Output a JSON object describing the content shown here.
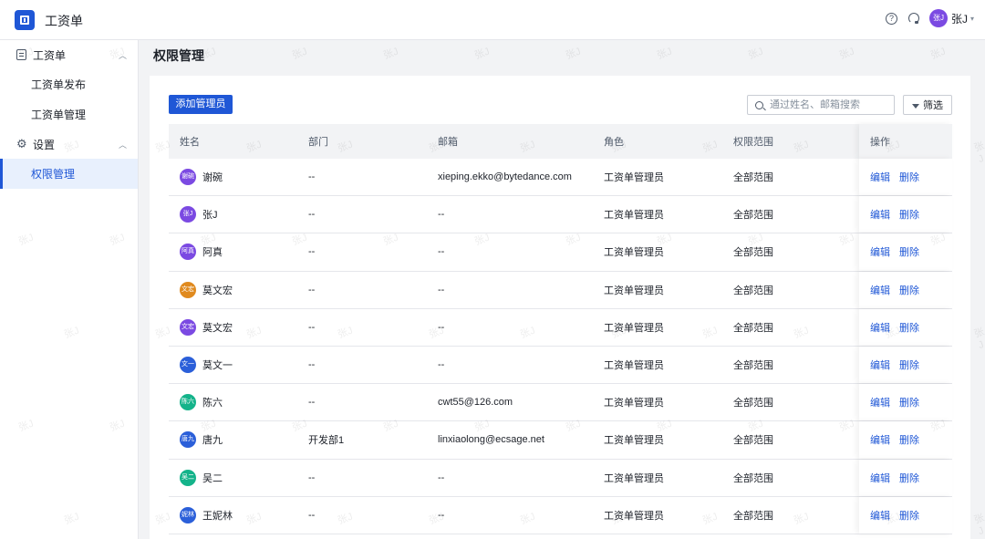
{
  "header": {
    "app_title": "工资单",
    "user_avatar_text": "张J",
    "user_name": "张J"
  },
  "sidebar": {
    "groups": [
      {
        "label": "工资单",
        "items": [
          "工资单发布",
          "工资单管理"
        ]
      },
      {
        "label": "设置",
        "items": [
          "权限管理"
        ]
      }
    ],
    "active_item": "权限管理"
  },
  "main": {
    "page_title": "权限管理",
    "add_button_label": "添加管理员",
    "search_placeholder": "通过姓名、邮箱搜索",
    "filter_label": "筛选",
    "table": {
      "columns": [
        "姓名",
        "部门",
        "邮箱",
        "角色",
        "权限范围",
        "操作"
      ],
      "rows": [
        {
          "avatar": "谢碗",
          "avatar_color": "#7b4ae2",
          "name": "谢碗",
          "dept": "--",
          "email": "xieping.ekko@bytedance.com",
          "role": "工资单管理员",
          "scope": "全部范围"
        },
        {
          "avatar": "张J",
          "avatar_color": "#7b4ae2",
          "name": "张J",
          "dept": "--",
          "email": "--",
          "role": "工资单管理员",
          "scope": "全部范围"
        },
        {
          "avatar": "阿真",
          "avatar_color": "#7b4ae2",
          "name": "阿真",
          "dept": "--",
          "email": "--",
          "role": "工资单管理员",
          "scope": "全部范围"
        },
        {
          "avatar": "文宏",
          "avatar_color": "#e08a1e",
          "name": "莫文宏",
          "dept": "--",
          "email": "--",
          "role": "工资单管理员",
          "scope": "全部范围"
        },
        {
          "avatar": "文宏",
          "avatar_color": "#7b4ae2",
          "name": "莫文宏",
          "dept": "--",
          "email": "--",
          "role": "工资单管理员",
          "scope": "全部范围"
        },
        {
          "avatar": "文一",
          "avatar_color": "#2b5fd9",
          "name": "莫文一",
          "dept": "--",
          "email": "--",
          "role": "工资单管理员",
          "scope": "全部范围"
        },
        {
          "avatar": "陈六",
          "avatar_color": "#14b38a",
          "name": "陈六",
          "dept": "--",
          "email": "cwt55@126.com",
          "role": "工资单管理员",
          "scope": "全部范围"
        },
        {
          "avatar": "唐九",
          "avatar_color": "#2b5fd9",
          "name": "唐九",
          "dept": "开发部1",
          "email": "linxiaolong@ecsage.net",
          "role": "工资单管理员",
          "scope": "全部范围"
        },
        {
          "avatar": "吴二",
          "avatar_color": "#14b38a",
          "name": "吴二",
          "dept": "--",
          "email": "--",
          "role": "工资单管理员",
          "scope": "全部范围"
        },
        {
          "avatar": "妮林",
          "avatar_color": "#2b5fd9",
          "name": "王妮林",
          "dept": "--",
          "email": "--",
          "role": "工资单管理员",
          "scope": "全部范围"
        }
      ],
      "edit_label": "编辑",
      "delete_label": "删除"
    }
  },
  "watermark_text": "张J"
}
